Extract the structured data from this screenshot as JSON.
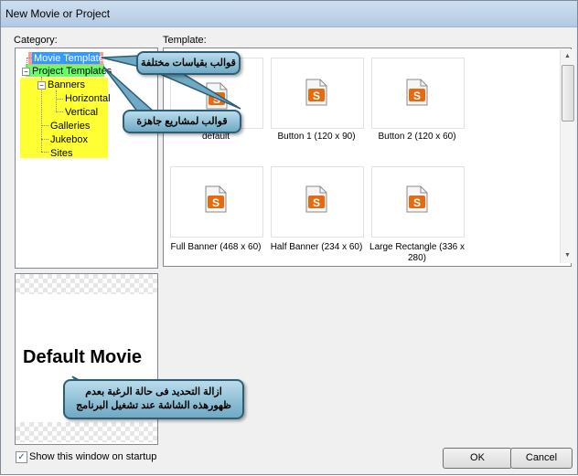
{
  "window": {
    "title": "New Movie or Project"
  },
  "labels": {
    "category": "Category:",
    "template": "Template:"
  },
  "tree": {
    "items": [
      {
        "label": "Movie Templates",
        "selected": true
      },
      {
        "label": "Project Templates"
      },
      {
        "label": "Banners"
      },
      {
        "label": "Horizontal"
      },
      {
        "label": "Vertical"
      },
      {
        "label": "Galleries"
      },
      {
        "label": "Jukebox"
      },
      {
        "label": "Sites"
      }
    ]
  },
  "templates": [
    {
      "label": "default"
    },
    {
      "label": "Button 1 (120 x 90)"
    },
    {
      "label": "Button 2 (120 x 60)"
    },
    {
      "label": "Full Banner (468 x 60)"
    },
    {
      "label": "Half Banner (234 x 60)"
    },
    {
      "label": "Large Rectangle (336 x 280)"
    }
  ],
  "preview": {
    "title": "Default Movie"
  },
  "callouts": {
    "movie_templates": "قوالب بقياسات مختلفة",
    "project_templates": "قوالب لمشاريع جاهزة",
    "startup": "ازالة التحديد فى حالة الرغبة بعدم ظهورهذه الشاشة عند تشغيل البرنامج"
  },
  "startup_checkbox": {
    "label": "Show this window on startup",
    "checked": true,
    "mark": "✓"
  },
  "buttons": {
    "ok": "OK",
    "cancel": "Cancel"
  },
  "colors": {
    "callout_border": "#2d5e78",
    "selection": "#3399ff",
    "highlight_yellow": "#ffff33",
    "highlight_green": "#66ff66",
    "highlight_red": "#ff9999",
    "icon_orange": "#e86a10"
  }
}
